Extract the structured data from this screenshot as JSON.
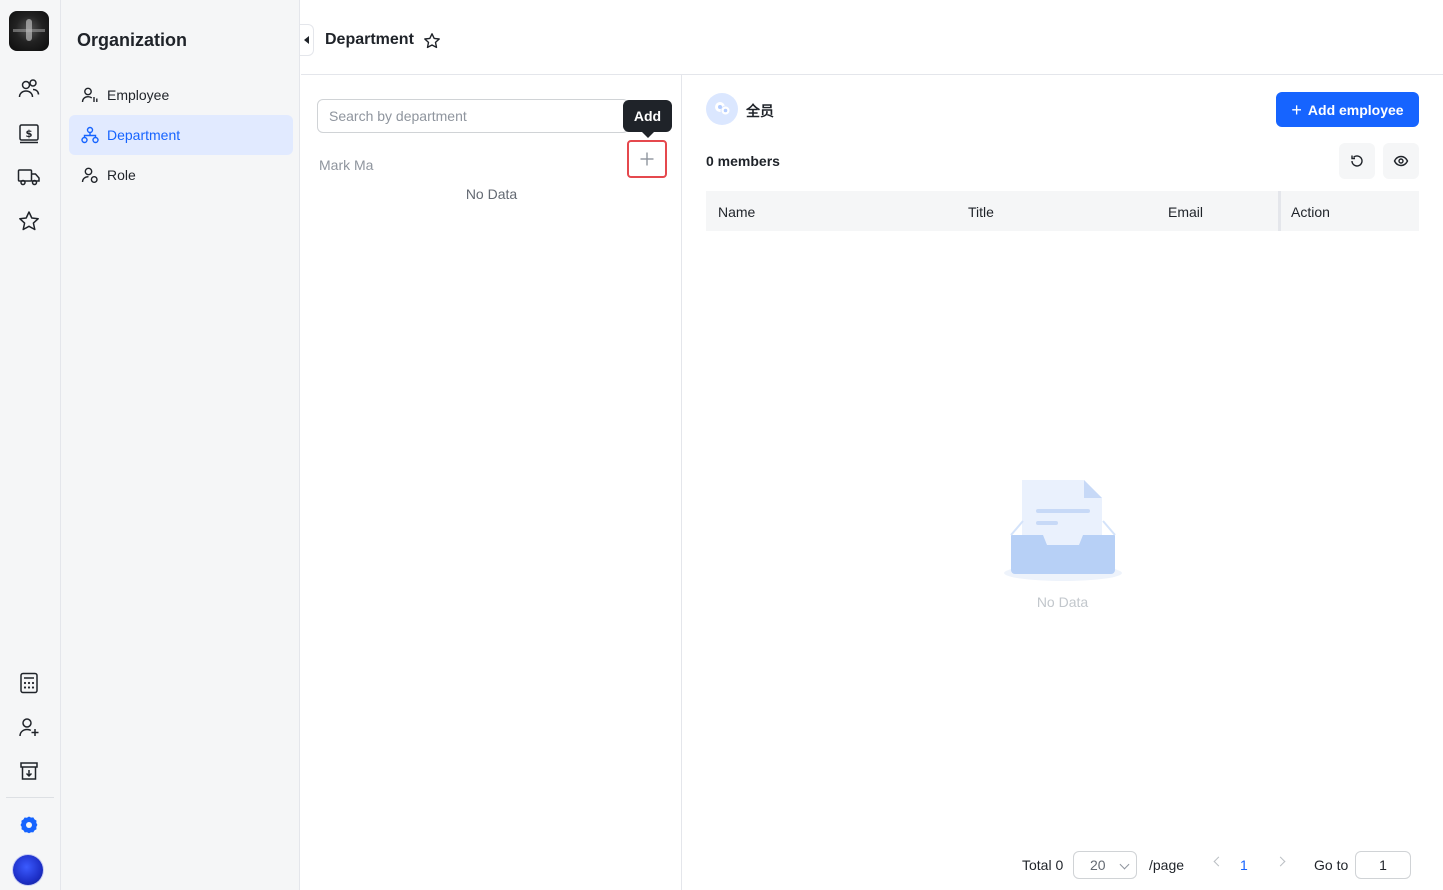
{
  "rail": {
    "top_icons": [
      "users-icon",
      "billing-icon",
      "truck-icon",
      "star-icon"
    ],
    "bottom_icons": [
      "calculator-icon",
      "add-user-icon",
      "download-box-icon",
      "settings-icon"
    ],
    "accent": "#1664ff"
  },
  "subnav": {
    "title": "Organization",
    "items": [
      {
        "label": "Employee",
        "icon": "person-list-icon",
        "active": false
      },
      {
        "label": "Department",
        "icon": "org-tree-icon",
        "active": true
      },
      {
        "label": "Role",
        "icon": "person-role-icon",
        "active": false
      }
    ]
  },
  "header": {
    "title": "Department"
  },
  "tree": {
    "search_placeholder": "Search by department",
    "root_label": "Mark Ma",
    "empty_text": "No Data",
    "add_tooltip": "Add"
  },
  "main": {
    "department_name": "全员",
    "add_employee_label": "Add employee",
    "members_count": "0 members",
    "columns": [
      "Name",
      "Title",
      "Email",
      "Action"
    ],
    "empty_text": "No Data"
  },
  "pagination": {
    "total_label": "Total 0",
    "page_size": "20",
    "per_page_label": "/page",
    "current_page": "1",
    "goto_label": "Go to",
    "goto_value": "1"
  }
}
